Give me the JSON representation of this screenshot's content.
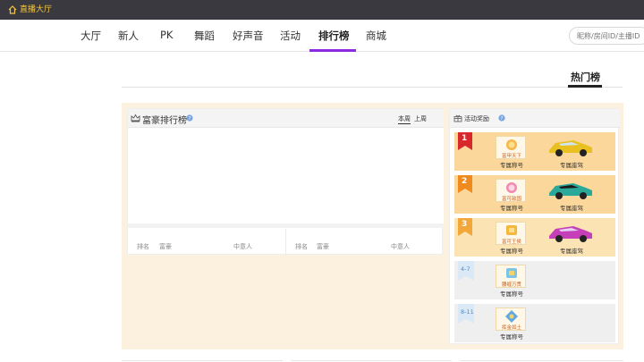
{
  "topbar": {
    "home_label": "直播大厅"
  },
  "nav": {
    "tabs": [
      {
        "label": "大厅"
      },
      {
        "label": "新人"
      },
      {
        "label": "PK"
      },
      {
        "label": "舞蹈"
      },
      {
        "label": "好声音"
      },
      {
        "label": "活动"
      },
      {
        "label": "排行榜"
      },
      {
        "label": "商城"
      }
    ],
    "active_tab": "排行榜",
    "search_placeholder": "昵称/房间ID/主播ID"
  },
  "section": {
    "title": "热门榜"
  },
  "rich_board": {
    "title": "富豪排行榜",
    "tabs": [
      "本周",
      "上周"
    ],
    "active_tab": "本周",
    "columns_left": [
      "排名",
      "富豪",
      "中意人"
    ],
    "columns_right": [
      "排名",
      "富豪",
      "中意人"
    ]
  },
  "rewards": {
    "title": "活动奖励",
    "items": [
      {
        "rank": "1",
        "badge": "富甲天下",
        "label1": "专属称号",
        "label2": "专属座驾",
        "bg": "#fbd79b",
        "flag": "#d9282b",
        "car": "#e8c020"
      },
      {
        "rank": "2",
        "badge": "富可敌国",
        "label1": "专属称号",
        "label2": "专属座驾",
        "bg": "#fbd79b",
        "flag": "#f08a1e",
        "car": "#2aa89a"
      },
      {
        "rank": "3",
        "badge": "富可王侯",
        "label1": "专属称号",
        "label2": "专属座驾",
        "bg": "#fbe3b4",
        "flag": "#f2a73a",
        "car": "#c43fb8"
      },
      {
        "rank": "4-7",
        "badge": "腰缠万贯",
        "label1": "专属称号",
        "bg": "#efefef",
        "flag": "#dbe9f6"
      },
      {
        "rank": "8-11",
        "badge": "挥金如土",
        "label1": "专属称号",
        "bg": "#efefef",
        "flag": "#dbe9f6"
      }
    ]
  },
  "colors": {
    "accent": "#8a2be2",
    "home": "#f2c744",
    "panel": "#fbf1de"
  }
}
